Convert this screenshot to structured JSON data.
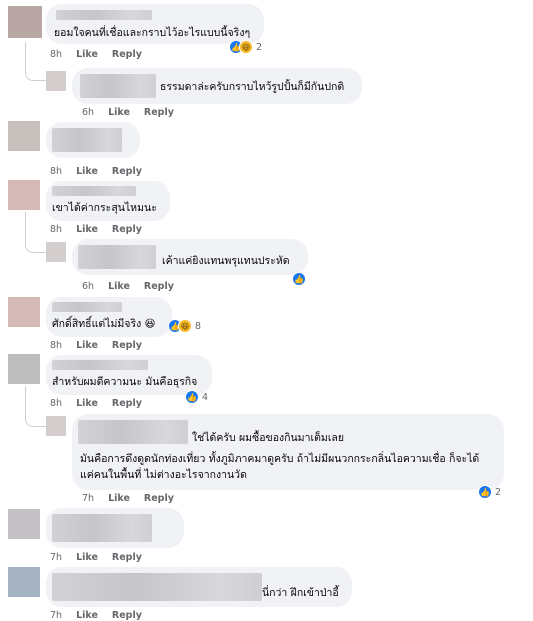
{
  "comments": [
    {
      "text": "ยอมใจคนที่เชื่อและกราบไว้อะไรแบบนี้จริงๆ",
      "time": "8h",
      "like": "Like",
      "reply": "Reply",
      "reaction_count": "2"
    },
    {
      "text": "ธรรมดาล่ะครับกราบไหว้รูปปั้นก็มีกันปกติ",
      "time": "6h",
      "like": "Like",
      "reply": "Reply"
    },
    {
      "text": "",
      "time": "8h",
      "like": "Like",
      "reply": "Reply"
    },
    {
      "text": "เขาได้ค่ากระสุนไหมนะ",
      "time": "8h",
      "like": "Like",
      "reply": "Reply"
    },
    {
      "text": "เค้าแค่ยิงแทนพรุแทนประหัด",
      "time": "6h",
      "like": "Like",
      "reply": "Reply"
    },
    {
      "text": "ศักดิ์สิทธิ์แต่ไม่มีจริง 😆",
      "time": "8h",
      "like": "Like",
      "reply": "Reply",
      "reaction_count": "8"
    },
    {
      "text": "สำหรับผมดีความนะ มันคือธุรกิจ",
      "time": "8h",
      "like": "Like",
      "reply": "Reply",
      "reaction_count": "4"
    },
    {
      "line1": "ใช่ได้ครับ ผมซื้อของกินมาเต็มเลย",
      "line2": "มันคือการดึงดูดนักท่องเที่ยว ทั้งภูมิภาคมาดูครับ ถ้าไม่มีผนวกกระกลิ่นไอความเชื่อ ก็จะได้",
      "line3": "แค่คนในพื้นที่ ไม่ต่างอะไรจากงานวัด",
      "time": "7h",
      "like": "Like",
      "reply": "Reply",
      "reaction_count": "2"
    },
    {
      "text": "",
      "time": "7h",
      "like": "Like",
      "reply": "Reply"
    },
    {
      "text": "นี่กว่า ฝึกเข้าป่าอี้",
      "time": "7h",
      "like": "Like",
      "reply": "Reply"
    }
  ],
  "colors": {
    "bubble": "#f0f2f5",
    "meta": "#65676b",
    "like_blue": "#1877f2"
  }
}
